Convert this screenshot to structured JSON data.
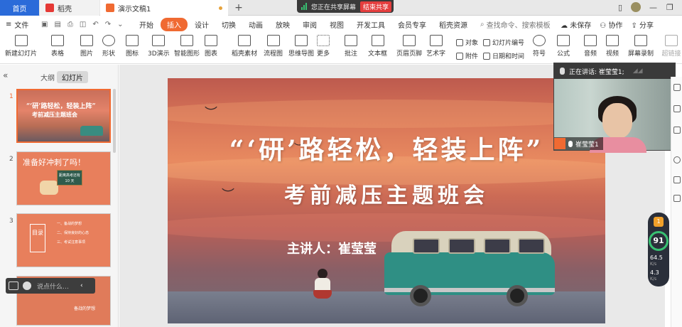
{
  "titlebar": {
    "tabs": [
      {
        "label": "首页"
      },
      {
        "label": "稻壳"
      },
      {
        "label": "演示文稿1"
      }
    ],
    "add_tab": "+",
    "share": {
      "status": "您正在共享屏幕",
      "stop_label": "结束共享"
    },
    "window_controls": {
      "minimize": "—",
      "restore": "❐"
    }
  },
  "menubar": {
    "file_label": "文件",
    "items": [
      "开始",
      "插入",
      "设计",
      "切换",
      "动画",
      "放映",
      "审阅",
      "视图",
      "开发工具",
      "会员专享",
      "稻壳资源"
    ],
    "active_index": 1,
    "search_placeholder": "查找命令、搜索模板",
    "right": [
      "未保存",
      "协作",
      "分享"
    ]
  },
  "toolbar": {
    "tools": [
      "新建幻灯片",
      "表格",
      "图片",
      "形状",
      "图标",
      "3D演示",
      "智能图形",
      "图表",
      "稻壳素材",
      "流程图",
      "思维导图",
      "更多",
      "批注",
      "文本框",
      "页眉页脚",
      "艺术字",
      "符号",
      "公式",
      "音频",
      "视频",
      "屏幕录制",
      "超链接"
    ],
    "small_tools": [
      "对象",
      "幻灯片编号",
      "附件",
      "日期和时间"
    ]
  },
  "leftpanel": {
    "tab_outline": "大纲",
    "tab_slides": "幻灯片",
    "slides": [
      {
        "num": "1",
        "title": "“‘研’路轻松，轻装上阵”",
        "subtitle": "考前减压主题班会"
      },
      {
        "num": "2",
        "title": "准备好冲刺了吗！",
        "board": "距离高考还有 10 天"
      },
      {
        "num": "3",
        "box": "目录",
        "items": [
          "一、备战的梦想",
          "二、保持良好的心态",
          "三、考试注意事项"
        ]
      },
      {
        "num": "4",
        "text": "备战的梦想"
      }
    ],
    "voice_placeholder": "说点什么…"
  },
  "slide": {
    "title": "“‘研’路轻松，轻装上阵”",
    "subtitle": "考前减压主题班会",
    "speaker": "主讲人：崔莹莹"
  },
  "video": {
    "speaking_label": "正在讲话:",
    "speaking_name": "崔莹莹1;",
    "participant_name": "崔莹莹1"
  },
  "stats": {
    "badge": "1",
    "score": "91",
    "upload": {
      "value": "64.5",
      "unit": "K/s"
    },
    "download": {
      "value": "4.3",
      "unit": "K/s"
    }
  },
  "colors": {
    "accent": "#f06a32",
    "home_tab": "#2b6bd9",
    "stop_share": "#e53e3e",
    "score_ring": "#38c172"
  }
}
